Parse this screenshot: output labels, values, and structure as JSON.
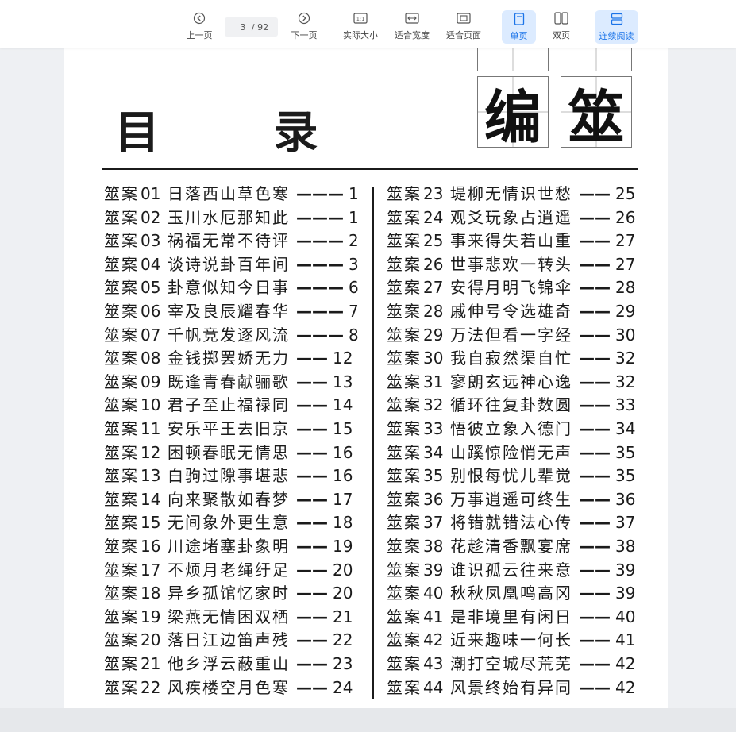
{
  "toolbar": {
    "prev_label": "上一页",
    "next_label": "下一页",
    "page_current": "3",
    "page_total": "/ 92",
    "actual_size_label": "实际大小",
    "fit_width_label": "适合宽度",
    "fit_page_label": "适合页面",
    "single_page_label": "单页",
    "double_page_label": "双页",
    "continuous_label": "连续阅读",
    "accent_color": "#1a73e8"
  },
  "document": {
    "title": "目 录",
    "big_chars": [
      "编",
      "筮"
    ],
    "prefix": "筮案",
    "left_entries": [
      {
        "num": "01",
        "name": "日落西山草色寒",
        "dash": "———",
        "page": "1"
      },
      {
        "num": "02",
        "name": "玉川水厄那知此",
        "dash": "———",
        "page": "1"
      },
      {
        "num": "03",
        "name": "祸福无常不待评",
        "dash": "———",
        "page": "2"
      },
      {
        "num": "04",
        "name": "谈诗说卦百年间",
        "dash": "———",
        "page": "3"
      },
      {
        "num": "05",
        "name": "卦意似知今日事",
        "dash": "———",
        "page": "6"
      },
      {
        "num": "06",
        "name": "宰及良辰耀春华",
        "dash": "———",
        "page": "7"
      },
      {
        "num": "07",
        "name": "千帆竞发逐风流",
        "dash": "———",
        "page": "8"
      },
      {
        "num": "08",
        "name": "金钱掷罢娇无力",
        "dash": "——",
        "page": "12"
      },
      {
        "num": "09",
        "name": "既逢青春献骊歌",
        "dash": "——",
        "page": "13"
      },
      {
        "num": "10",
        "name": "君子至止福禄同",
        "dash": "——",
        "page": "14"
      },
      {
        "num": "11",
        "name": "安乐平王去旧京",
        "dash": "——",
        "page": "15"
      },
      {
        "num": "12",
        "name": "困顿春眠无情思",
        "dash": "——",
        "page": "16"
      },
      {
        "num": "13",
        "name": "白驹过隙事堪悲",
        "dash": "——",
        "page": "16"
      },
      {
        "num": "14",
        "name": "向来聚散如春梦",
        "dash": "——",
        "page": "17"
      },
      {
        "num": "15",
        "name": "无间象外更生意",
        "dash": "——",
        "page": "18"
      },
      {
        "num": "16",
        "name": "川途堵塞卦象明",
        "dash": "——",
        "page": "19"
      },
      {
        "num": "17",
        "name": "不烦月老绳纡足",
        "dash": "——",
        "page": "20"
      },
      {
        "num": "18",
        "name": "异乡孤馆忆家时",
        "dash": "——",
        "page": "20"
      },
      {
        "num": "19",
        "name": "梁燕无情困双栖",
        "dash": "——",
        "page": "21"
      },
      {
        "num": "20",
        "name": "落日江边笛声残",
        "dash": "——",
        "page": "22"
      },
      {
        "num": "21",
        "name": "他乡浮云蔽重山",
        "dash": "——",
        "page": "23"
      },
      {
        "num": "22",
        "name": "风疾楼空月色寒",
        "dash": "——",
        "page": "24"
      }
    ],
    "right_entries": [
      {
        "num": "23",
        "name": "堤柳无情识世愁",
        "dash": "——",
        "page": "25"
      },
      {
        "num": "24",
        "name": "观爻玩象占逍遥",
        "dash": "——",
        "page": "26"
      },
      {
        "num": "25",
        "name": "事来得失若山重",
        "dash": "——",
        "page": "27"
      },
      {
        "num": "26",
        "name": "世事悲欢一转头",
        "dash": "——",
        "page": "27"
      },
      {
        "num": "27",
        "name": "安得月明飞锦伞",
        "dash": "——",
        "page": "28"
      },
      {
        "num": "28",
        "name": "戚伸号令选雄奇",
        "dash": "——",
        "page": "29"
      },
      {
        "num": "29",
        "name": "万法但看一字经",
        "dash": "——",
        "page": "30"
      },
      {
        "num": "30",
        "name": "我自寂然渠自忙",
        "dash": "——",
        "page": "32"
      },
      {
        "num": "31",
        "name": "寥朗玄远神心逸",
        "dash": "——",
        "page": "32"
      },
      {
        "num": "32",
        "name": "循环往复卦数圆",
        "dash": "——",
        "page": "33"
      },
      {
        "num": "33",
        "name": "悟彼立象入德门",
        "dash": "——",
        "page": "34"
      },
      {
        "num": "34",
        "name": "山蹊惊险悄无声",
        "dash": "——",
        "page": "35"
      },
      {
        "num": "35",
        "name": "别恨每忧儿辈觉",
        "dash": "——",
        "page": "35"
      },
      {
        "num": "36",
        "name": "万事逍遥可终生",
        "dash": "——",
        "page": "36"
      },
      {
        "num": "37",
        "name": "将错就错法心传",
        "dash": "——",
        "page": "37"
      },
      {
        "num": "38",
        "name": "花趁清香飘宴席",
        "dash": "——",
        "page": "38"
      },
      {
        "num": "39",
        "name": "谁识孤云往来意",
        "dash": "——",
        "page": "39"
      },
      {
        "num": "40",
        "name": "秋秋凤凰鸣高冈",
        "dash": "——",
        "page": "39"
      },
      {
        "num": "41",
        "name": "是非境里有闲日",
        "dash": "——",
        "page": "40"
      },
      {
        "num": "42",
        "name": "近来趣味一何长",
        "dash": "——",
        "page": "41"
      },
      {
        "num": "43",
        "name": "潮打空城尽荒芜",
        "dash": "——",
        "page": "42"
      },
      {
        "num": "44",
        "name": "风景终始有异同",
        "dash": "——",
        "page": "42"
      }
    ]
  }
}
